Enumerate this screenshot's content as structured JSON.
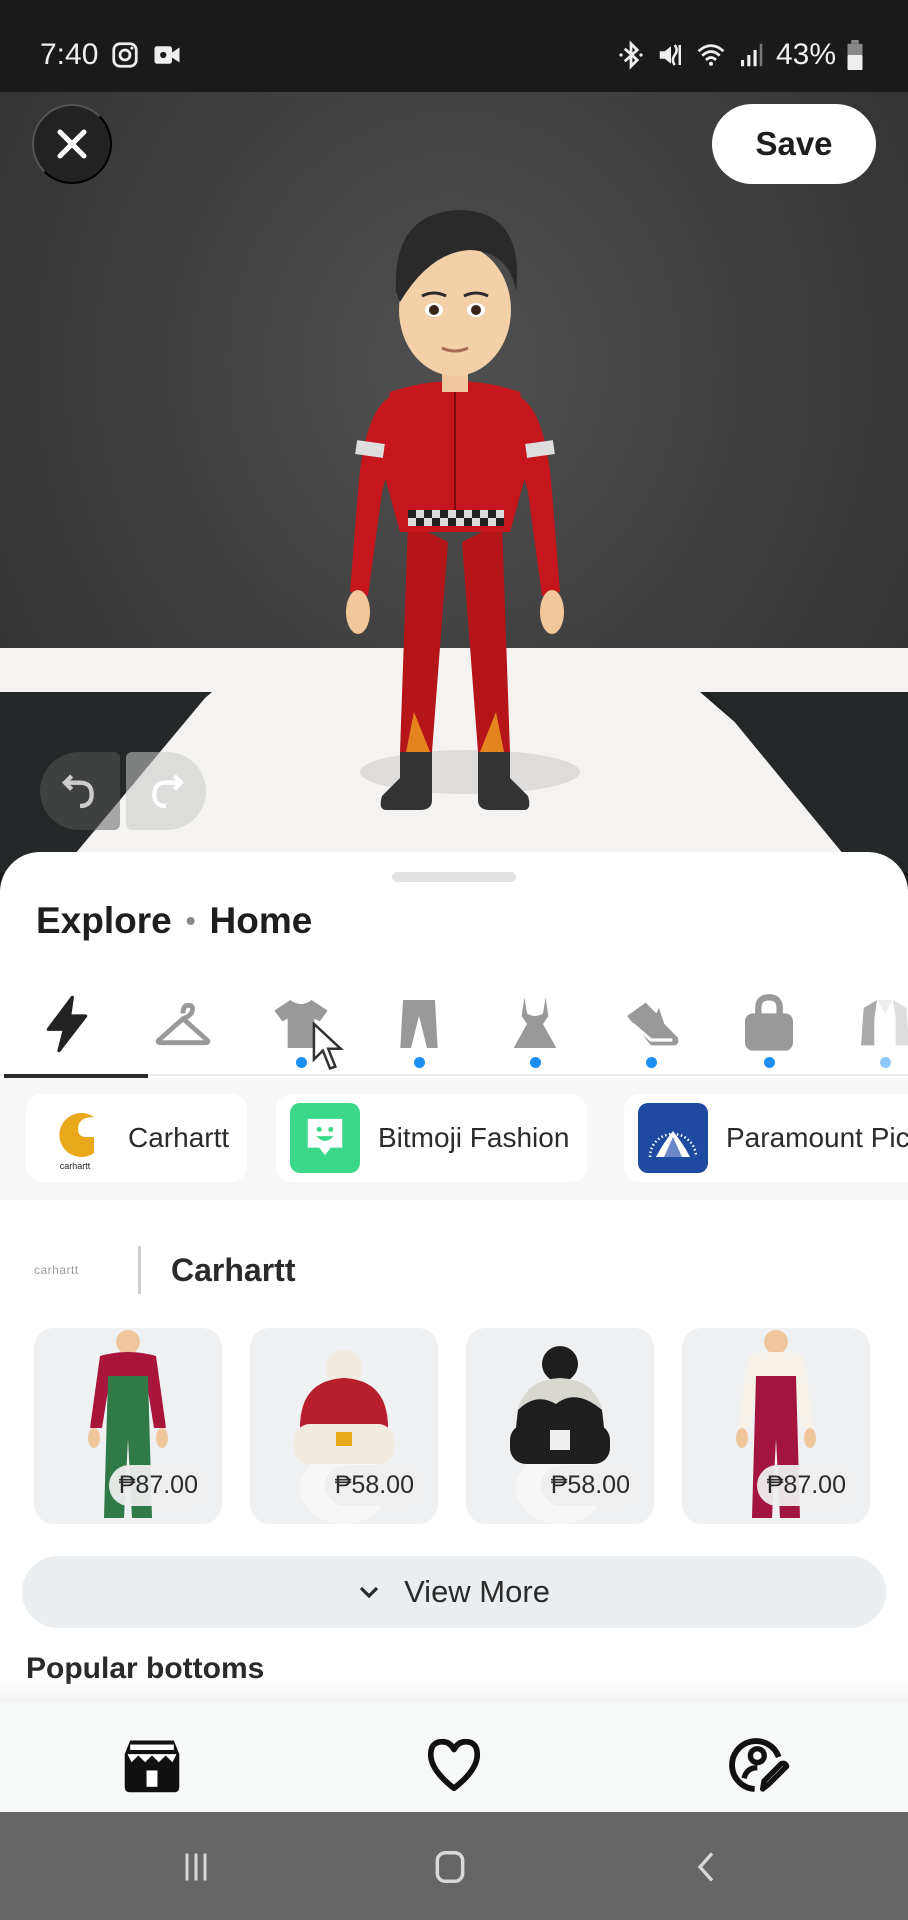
{
  "status_bar": {
    "time": "7:40",
    "left_icons": [
      "instagram-icon",
      "video-camera-icon"
    ],
    "right_icons": [
      "bluetooth-icon",
      "mute-icon",
      "wifi-icon",
      "signal-icon"
    ],
    "battery": "43%"
  },
  "scene": {
    "close_icon": "close-icon",
    "save_label": "Save",
    "undo_icon": "undo-icon",
    "redo_icon": "redo-icon"
  },
  "sheet": {
    "breadcrumb": [
      "Explore",
      "Home"
    ],
    "categories": [
      {
        "id": "featured",
        "icon": "lightning-icon",
        "active": true,
        "badge": false
      },
      {
        "id": "outfits",
        "icon": "hanger-icon",
        "active": false,
        "badge": false
      },
      {
        "id": "tops",
        "icon": "tshirt-icon",
        "active": false,
        "badge": true
      },
      {
        "id": "bottoms",
        "icon": "pants-icon",
        "active": false,
        "badge": true
      },
      {
        "id": "dresses",
        "icon": "dress-icon",
        "active": false,
        "badge": true
      },
      {
        "id": "shoes",
        "icon": "sneaker-icon",
        "active": false,
        "badge": true
      },
      {
        "id": "accessories",
        "icon": "bag-icon",
        "active": false,
        "badge": true
      },
      {
        "id": "outerwear",
        "icon": "jacket-icon",
        "active": false,
        "badge": true
      }
    ],
    "brands": [
      {
        "name": "Carhartt",
        "logo_text": "carhartt"
      },
      {
        "name": "Bitmoji Fashion"
      },
      {
        "name": "Paramount Pic"
      }
    ],
    "section": {
      "logo_text": "carhartt",
      "title": "Carhartt",
      "products": [
        {
          "type": "overalls-green",
          "price": "₱87.00"
        },
        {
          "type": "beanie-red",
          "price": "₱58.00"
        },
        {
          "type": "beanie-black",
          "price": "₱58.00"
        },
        {
          "type": "overalls-maroon",
          "price": "₱87.00"
        }
      ]
    },
    "view_more_label": "View More",
    "next_section_title": "Popular bottoms"
  },
  "bottom_nav": [
    "store-icon",
    "heart-icon",
    "avatar-edit-icon"
  ],
  "system_nav": [
    "recents-icon",
    "home-icon",
    "back-icon"
  ],
  "colors": {
    "accent_badge": "#1d8ff2",
    "bitmoji_green": "#3cd88a",
    "carhartt_gold": "#e8a81a",
    "paramount_blue": "#1e4aa0",
    "suit_red": "#c0171c"
  }
}
